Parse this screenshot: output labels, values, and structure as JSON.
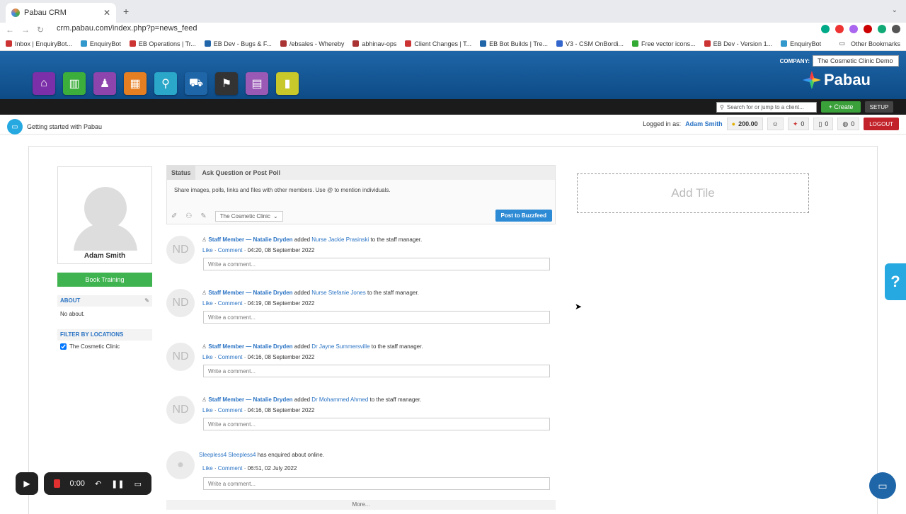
{
  "browser": {
    "tab_title": "Pabau CRM",
    "url": "crm.pabau.com/index.php?p=news_feed",
    "bookmarks": [
      "Inbox | EnquiryBot...",
      "EnquiryBot",
      "EB Operations | Tr...",
      "EB Dev - Bugs & F...",
      "/ebsales - Whereby",
      "abhinav-ops",
      "Client Changes | T...",
      "EB Bot Builds | Tre...",
      "V3 - CSM OnBordi...",
      "Free vector icons...",
      "EB Dev - Version 1...",
      "EnquiryBot"
    ],
    "other_bookmarks": "Other Bookmarks"
  },
  "header": {
    "company_label": "COMPANY:",
    "company_value": "The Cosmetic Clinic Demo",
    "logo_text": "Pabau",
    "search_placeholder": "Search for or jump to a client...",
    "create_label": "+ Create",
    "setup_label": "SETUP"
  },
  "userbar": {
    "getting_started": "Getting started with Pabau",
    "logged_in_label": "Logged in as:",
    "user_name": "Adam Smith",
    "credits": "200.00",
    "count1": "0",
    "count2": "0",
    "count3": "0",
    "logout": "LOGOUT"
  },
  "profile": {
    "name": "Adam Smith",
    "book_training": "Book Training",
    "about_heading": "ABOUT",
    "about_text": "No about.",
    "filter_heading": "FILTER BY LOCATIONS",
    "location": "The Cosmetic Clinic"
  },
  "poster": {
    "tab_status": "Status",
    "tab_ask": "Ask Question or Post Poll",
    "hint": "Share images, polls, links and files with other members. Use @ to mention individuals.",
    "location": "The Cosmetic Clinic",
    "post_button": "Post to Buzzfeed"
  },
  "feed": [
    {
      "initials": "ND",
      "actor": "Staff Member — Natalie Dryden",
      "verb": "added",
      "target": "Nurse Jackie Prasinski",
      "rest": "to the staff manager.",
      "like": "Like",
      "comment": "Comment",
      "time": "04:20, 08 September 2022",
      "placeholder": "Write a comment..."
    },
    {
      "initials": "ND",
      "actor": "Staff Member — Natalie Dryden",
      "verb": "added",
      "target": "Nurse Stefanie Jones",
      "rest": "to the staff manager.",
      "like": "Like",
      "comment": "Comment",
      "time": "04:19, 08 September 2022",
      "placeholder": "Write a comment..."
    },
    {
      "initials": "ND",
      "actor": "Staff Member — Natalie Dryden",
      "verb": "added",
      "target": "Dr Jayne Summersville",
      "rest": "to the staff manager.",
      "like": "Like",
      "comment": "Comment",
      "time": "04:16, 08 September 2022",
      "placeholder": "Write a comment..."
    },
    {
      "initials": "ND",
      "actor": "Staff Member — Natalie Dryden",
      "verb": "added",
      "target": "Dr Mohammed Ahmed",
      "rest": "to the staff manager.",
      "like": "Like",
      "comment": "Comment",
      "time": "04:16, 08 September 2022",
      "placeholder": "Write a comment..."
    }
  ],
  "enquiry": {
    "actor": "Sleepless4 Sleepless4",
    "rest": "has enquired about online.",
    "like": "Like",
    "comment": "Comment",
    "time": "06:51, 02 July 2022",
    "placeholder": "Write a comment..."
  },
  "more": "More...",
  "add_tile": "Add Tile",
  "recorder": {
    "time": "0:00"
  },
  "help": "?"
}
